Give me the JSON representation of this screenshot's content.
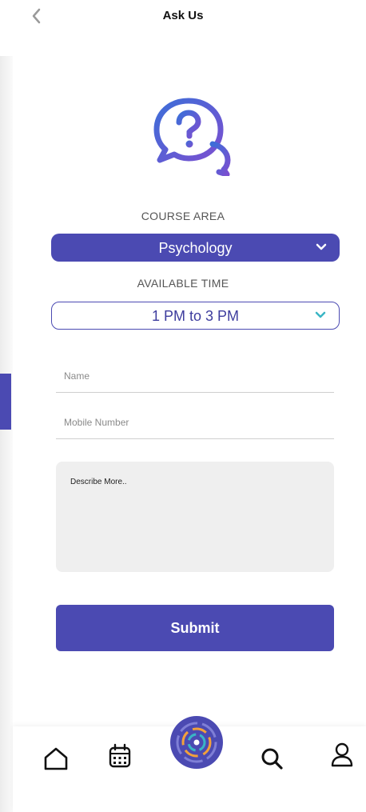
{
  "header": {
    "title": "Ask Us"
  },
  "course_area": {
    "label": "COURSE AREA",
    "value": "Psychology"
  },
  "available_time": {
    "label": "AVAILABLE TIME",
    "value": "1 PM to 3 PM"
  },
  "form": {
    "name_placeholder": "Name",
    "mobile_placeholder": "Mobile Number",
    "describe_placeholder": "Describe More..",
    "submit_label": "Submit"
  },
  "icons": {
    "back": "chevron-left-icon",
    "help": "question-chat-bubbles-icon",
    "home": "home-icon",
    "calendar": "calendar-icon",
    "center": "brand-logo-icon",
    "search": "search-icon",
    "profile": "user-icon"
  },
  "colors": {
    "primary": "#4b4ab2",
    "accent_teal": "#3ab5c5",
    "accent_orange": "#f2a13b"
  }
}
